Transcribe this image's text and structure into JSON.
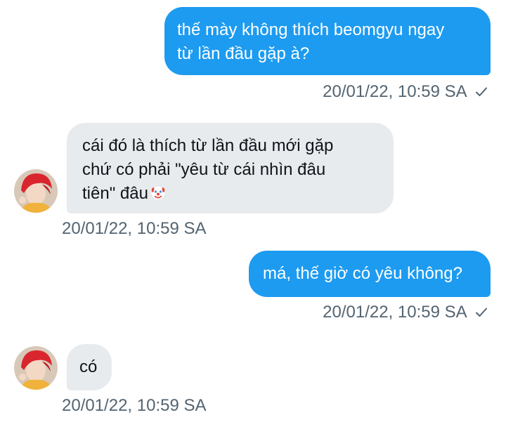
{
  "messages": [
    {
      "direction": "outgoing",
      "lines": [
        "thế mày không thích beomgyu ngay",
        "từ lần đầu gặp à?"
      ],
      "timestamp": "20/01/22, 10:59 SA",
      "status_icon": "check-icon"
    },
    {
      "direction": "incoming",
      "lines": [
        "cái đó là thích từ lần đầu mới gặp",
        "chứ có phải \"yêu từ cái nhìn đâu",
        "tiên\" đâu"
      ],
      "emoji": "clown-face-emoji",
      "timestamp": "20/01/22, 10:59 SA",
      "avatar": "avatar-red-hair"
    },
    {
      "direction": "outgoing",
      "lines": [
        "má, thế giờ có yêu không?"
      ],
      "timestamp": "20/01/22, 10:59 SA",
      "status_icon": "check-icon"
    },
    {
      "direction": "incoming",
      "lines": [
        "có"
      ],
      "timestamp": "20/01/22, 10:59 SA",
      "avatar": "avatar-red-hair"
    }
  ],
  "colors": {
    "outgoing_bubble": "#1d9bf0",
    "incoming_bubble": "#e8ebee",
    "timestamp": "#536471"
  }
}
